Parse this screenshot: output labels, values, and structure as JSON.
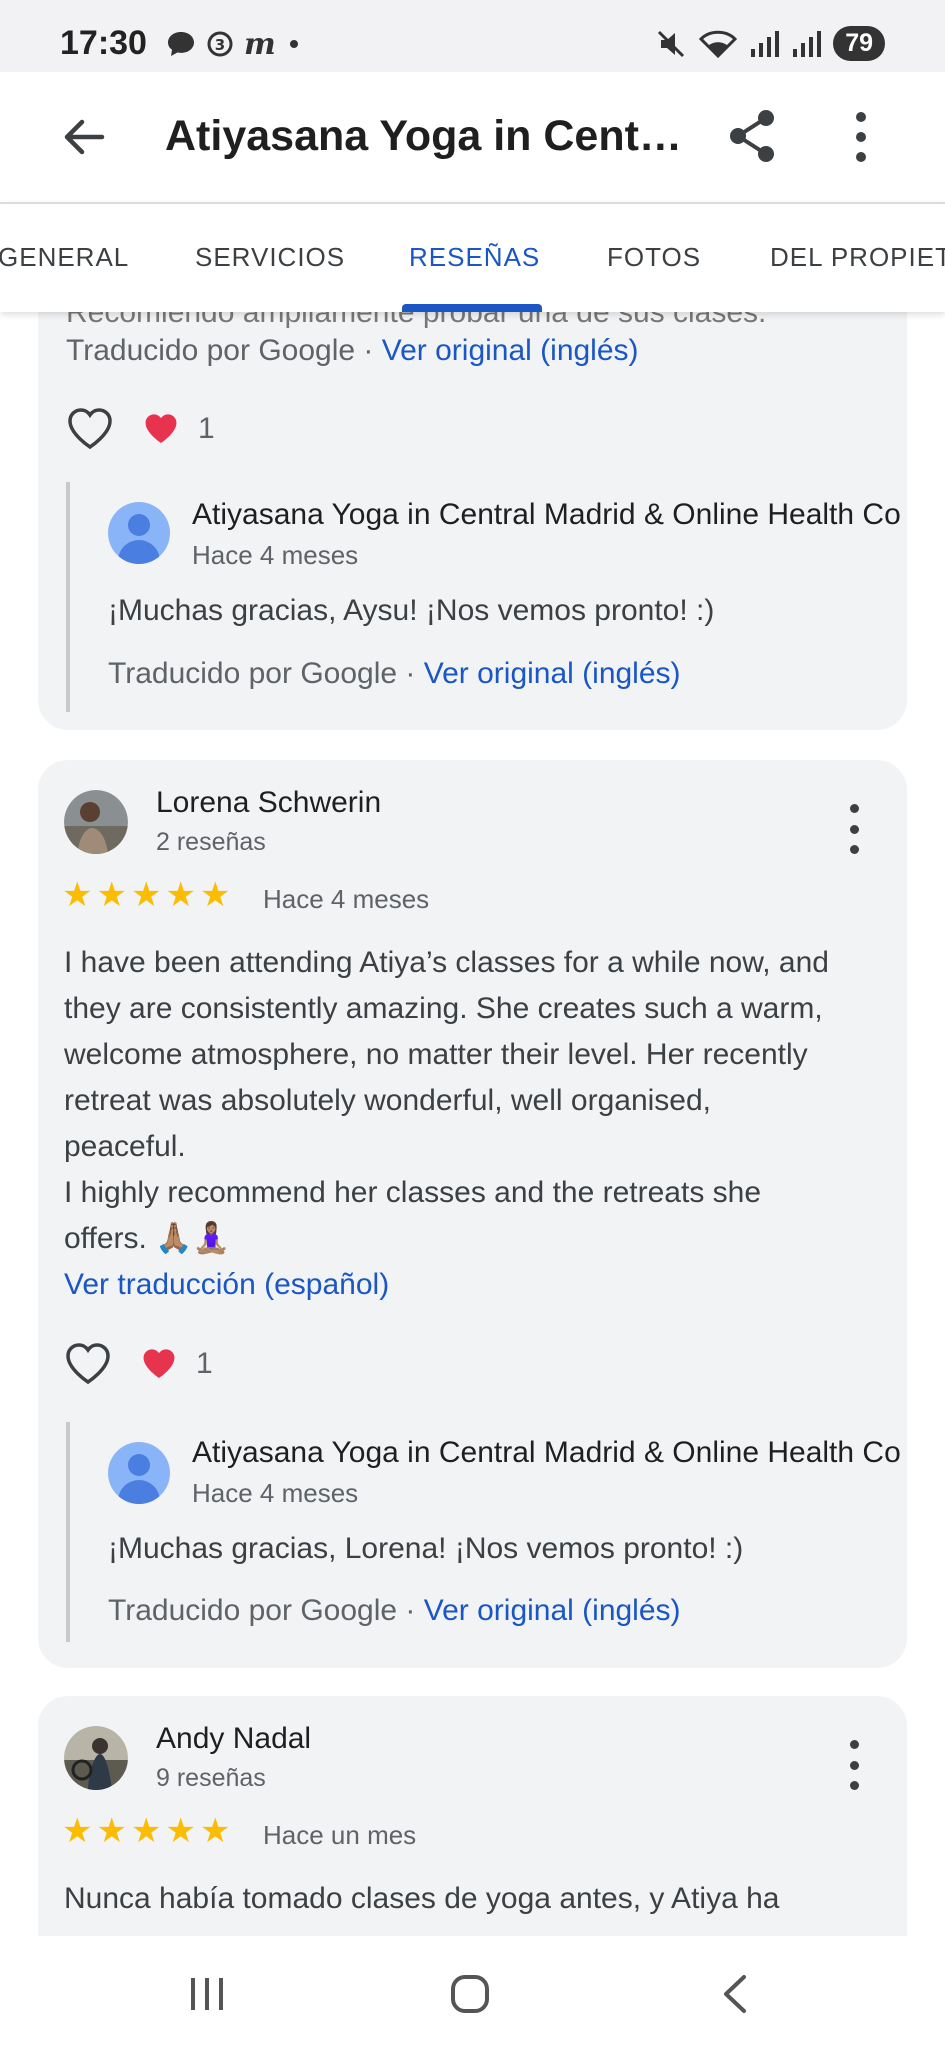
{
  "status_bar": {
    "time": "17:30",
    "battery": "79",
    "notification_icons": [
      "chat-bubble-icon",
      "data-saver-icon",
      "m-app-icon",
      "dot-icon"
    ],
    "system_icons": [
      "mute-icon",
      "wifi-icon",
      "signal-icon",
      "signal-icon"
    ]
  },
  "app_bar": {
    "title": "Atiyasana Yoga in Cent…"
  },
  "tabs": [
    {
      "label": "GENERAL"
    },
    {
      "label": "SERVICIOS"
    },
    {
      "label": "RESEÑAS",
      "active": true
    },
    {
      "label": "FOTOS"
    },
    {
      "label": "DEL PROPIET."
    }
  ],
  "review_prev": {
    "cut_text": "Recomiendo ampliamente probar una de sus clases.",
    "translated_by": "Traducido por Google ·",
    "view_original": "Ver original (inglés)",
    "like_count": "1",
    "reply": {
      "author": "Atiyasana Yoga in Central Madrid & Online Health Co",
      "time": "Hace 4 meses",
      "text": "¡Muchas gracias, Aysu! ¡Nos vemos pronto! :)",
      "translated_by": "Traducido por Google ·",
      "view_original": "Ver original (inglés)"
    }
  },
  "review_lorena": {
    "name": "Lorena Schwerin",
    "reviews_count": "2 reseñas",
    "rating": 5,
    "time": "Hace 4 meses",
    "lines": [
      "I have been attending Atiya’s classes for a while now, and",
      "they are consistently amazing. She creates such a warm,",
      "welcome atmosphere, no matter their level. Her recently",
      "retreat was absolutely wonderful, well organised,",
      "peaceful.",
      "I highly recommend her classes and the retreats she",
      "offers. 🙏🏽🧘🏽‍♀️"
    ],
    "translate_link": "Ver traducción (español)",
    "like_count": "1",
    "reply": {
      "author": "Atiyasana Yoga in Central Madrid & Online Health Co",
      "time": "Hace 4 meses",
      "text": "¡Muchas gracias, Lorena! ¡Nos vemos pronto! :)",
      "translated_by": "Traducido por Google ·",
      "view_original": "Ver original (inglés)"
    }
  },
  "review_andy": {
    "name": "Andy Nadal",
    "reviews_count": "9 reseñas",
    "rating": 5,
    "time": "Hace un mes",
    "line1": "Nunca había tomado clases de yoga antes, y Atiya ha"
  },
  "nav_bar": {
    "icons": [
      "recent-apps-icon",
      "home-icon",
      "back-nav-icon"
    ]
  },
  "colors": {
    "accent": "#1a56c4",
    "star": "#fbbc04",
    "heart": "#e8334f",
    "card_bg": "#f2f3f5"
  }
}
